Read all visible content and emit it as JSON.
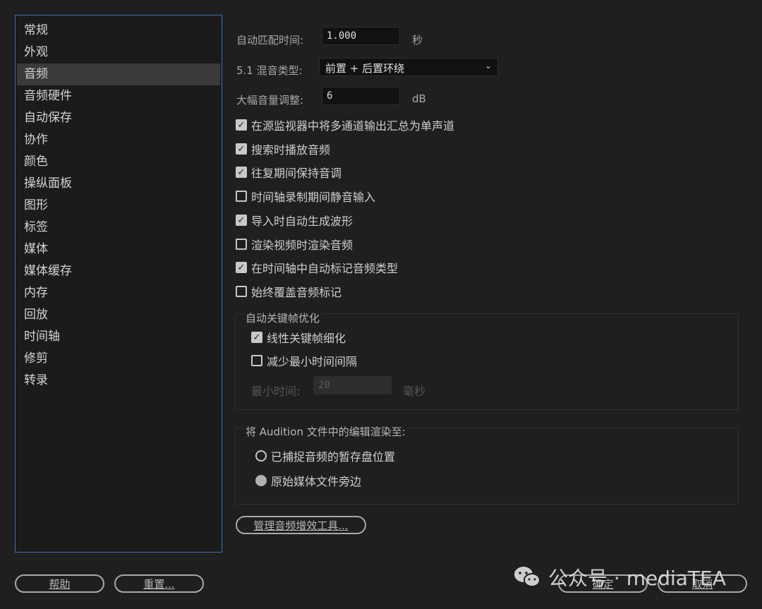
{
  "sidebar": {
    "items": [
      {
        "label": "常规"
      },
      {
        "label": "外观"
      },
      {
        "label": "音频",
        "selected": true
      },
      {
        "label": "音频硬件"
      },
      {
        "label": "自动保存"
      },
      {
        "label": "协作"
      },
      {
        "label": "颜色"
      },
      {
        "label": "操纵面板"
      },
      {
        "label": "图形"
      },
      {
        "label": "标签"
      },
      {
        "label": "媒体"
      },
      {
        "label": "媒体缓存"
      },
      {
        "label": "内存"
      },
      {
        "label": "回放"
      },
      {
        "label": "时间轴"
      },
      {
        "label": "修剪"
      },
      {
        "label": "转录"
      }
    ]
  },
  "audio": {
    "automatch": {
      "label": "自动匹配时间:",
      "value": "1.000",
      "unit": "秒"
    },
    "mix51": {
      "label": "5.1 混音类型:",
      "value": "前置 + 后置环绕"
    },
    "gain": {
      "label": "大幅音量调整:",
      "value": "6",
      "unit": "dB"
    },
    "checkboxes": [
      {
        "label": "在源监视器中将多通道输出汇总为单声道",
        "checked": true
      },
      {
        "label": "搜索时播放音频",
        "checked": true
      },
      {
        "label": "往复期间保持音调",
        "checked": true
      },
      {
        "label": "时间轴录制期间静音输入",
        "checked": false
      },
      {
        "label": "导入时自动生成波形",
        "checked": true
      },
      {
        "label": "渲染视频时渲染音频",
        "checked": false
      },
      {
        "label": "在时间轴中自动标记音频类型",
        "checked": true
      },
      {
        "label": "始终覆盖音频标记",
        "checked": false
      }
    ],
    "keyframe_group": {
      "title": "自动关键帧优化",
      "linear": {
        "label": "线性关键帧细化",
        "checked": true
      },
      "reduce": {
        "label": "减少最小时间间隔",
        "checked": false
      },
      "min_time": {
        "label": "最小时间:",
        "value": "20",
        "unit": "毫秒"
      }
    },
    "audition_group": {
      "title": "将 Audition 文件中的编辑渲染至:",
      "options": [
        {
          "label": "已捕捉音频的暂存盘位置",
          "selected": false
        },
        {
          "label": "原始媒体文件旁边",
          "selected": true
        }
      ]
    },
    "manage_plugins_label": "管理音频增效工具..."
  },
  "footer": {
    "help_label": "帮助",
    "reset_label": "重置...",
    "ok_label": "确定",
    "cancel_label": "取消"
  },
  "watermark": {
    "text": "公众号 · mediaTEA"
  }
}
